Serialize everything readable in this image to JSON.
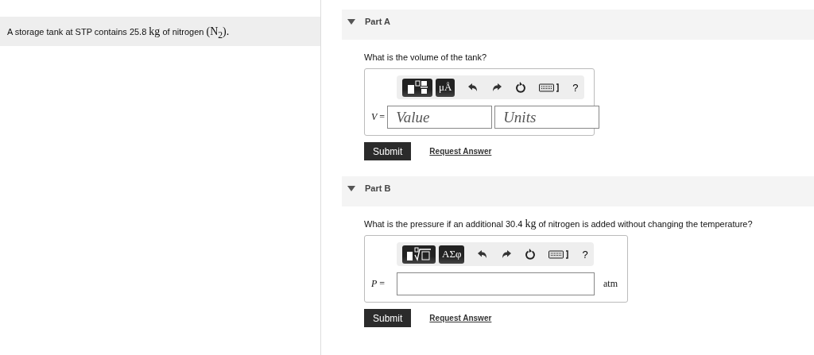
{
  "problem": [
    {
      "kind": "text",
      "text": "A storage tank at STP contains 25.8"
    },
    {
      "kind": "math",
      "text": "kg"
    },
    {
      "kind": "text",
      "text": "of nitrogen"
    },
    {
      "kind": "math",
      "text": "(N$_{2}$)."
    }
  ],
  "parts": [
    {
      "title": "Part A",
      "expanded": true,
      "kind": "value_units",
      "question": [
        {
          "kind": "text",
          "text": "What is the volume of the tank?"
        }
      ],
      "symbols": "μÅ",
      "help": "?",
      "variable": "V",
      "equals": "=",
      "value_placeholder": "Value",
      "units_placeholder": "Units",
      "submit": "Submit",
      "request": "Request Answer"
    },
    {
      "title": "Part B",
      "expanded": true,
      "kind": "value_fixed_units",
      "question": [
        {
          "kind": "text",
          "text": "What is the pressure if an additional 30.4"
        },
        {
          "kind": "math",
          "text": "kg"
        },
        {
          "kind": "text",
          "text": "of nitrogen is added without changing the temperature?"
        }
      ],
      "symbols": "ΑΣφ",
      "help": "?",
      "variable": "P",
      "equals": "=",
      "units": "atm",
      "submit": "Submit",
      "request": "Request Answer"
    }
  ]
}
